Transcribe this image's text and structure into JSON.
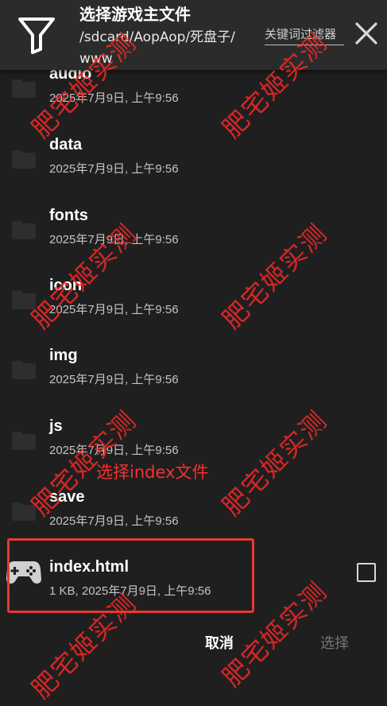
{
  "header": {
    "title": "选择游戏主文件",
    "path": "/sdcard/AopAop/死盘子/www",
    "keyword_filter_placeholder": "关键词过滤器"
  },
  "files": [
    {
      "name": "audio",
      "meta": "2025年7月9日, 上午9:56",
      "type": "folder"
    },
    {
      "name": "data",
      "meta": "2025年7月9日, 上午9:56",
      "type": "folder"
    },
    {
      "name": "fonts",
      "meta": "2025年7月9日, 上午9:56",
      "type": "folder"
    },
    {
      "name": "icon",
      "meta": "2025年7月9日, 上午9:56",
      "type": "folder"
    },
    {
      "name": "img",
      "meta": "2025年7月9日, 上午9:56",
      "type": "folder"
    },
    {
      "name": "js",
      "meta": "2025年7月9日, 上午9:56",
      "type": "folder"
    },
    {
      "name": "save",
      "meta": "2025年7月9日, 上午9:56",
      "type": "folder"
    },
    {
      "name": "index.html",
      "meta": "1 KB, 2025年7月9日, 上午9:56",
      "type": "game-file"
    }
  ],
  "annotation": "选择index文件",
  "buttons": {
    "cancel": "取消",
    "select": "选择"
  },
  "watermark": "肥宅姬实测",
  "colors": {
    "background": "#1f1f1f",
    "header": "#2b2b2b",
    "highlight": "#e53935",
    "watermark": "#ff2828"
  }
}
